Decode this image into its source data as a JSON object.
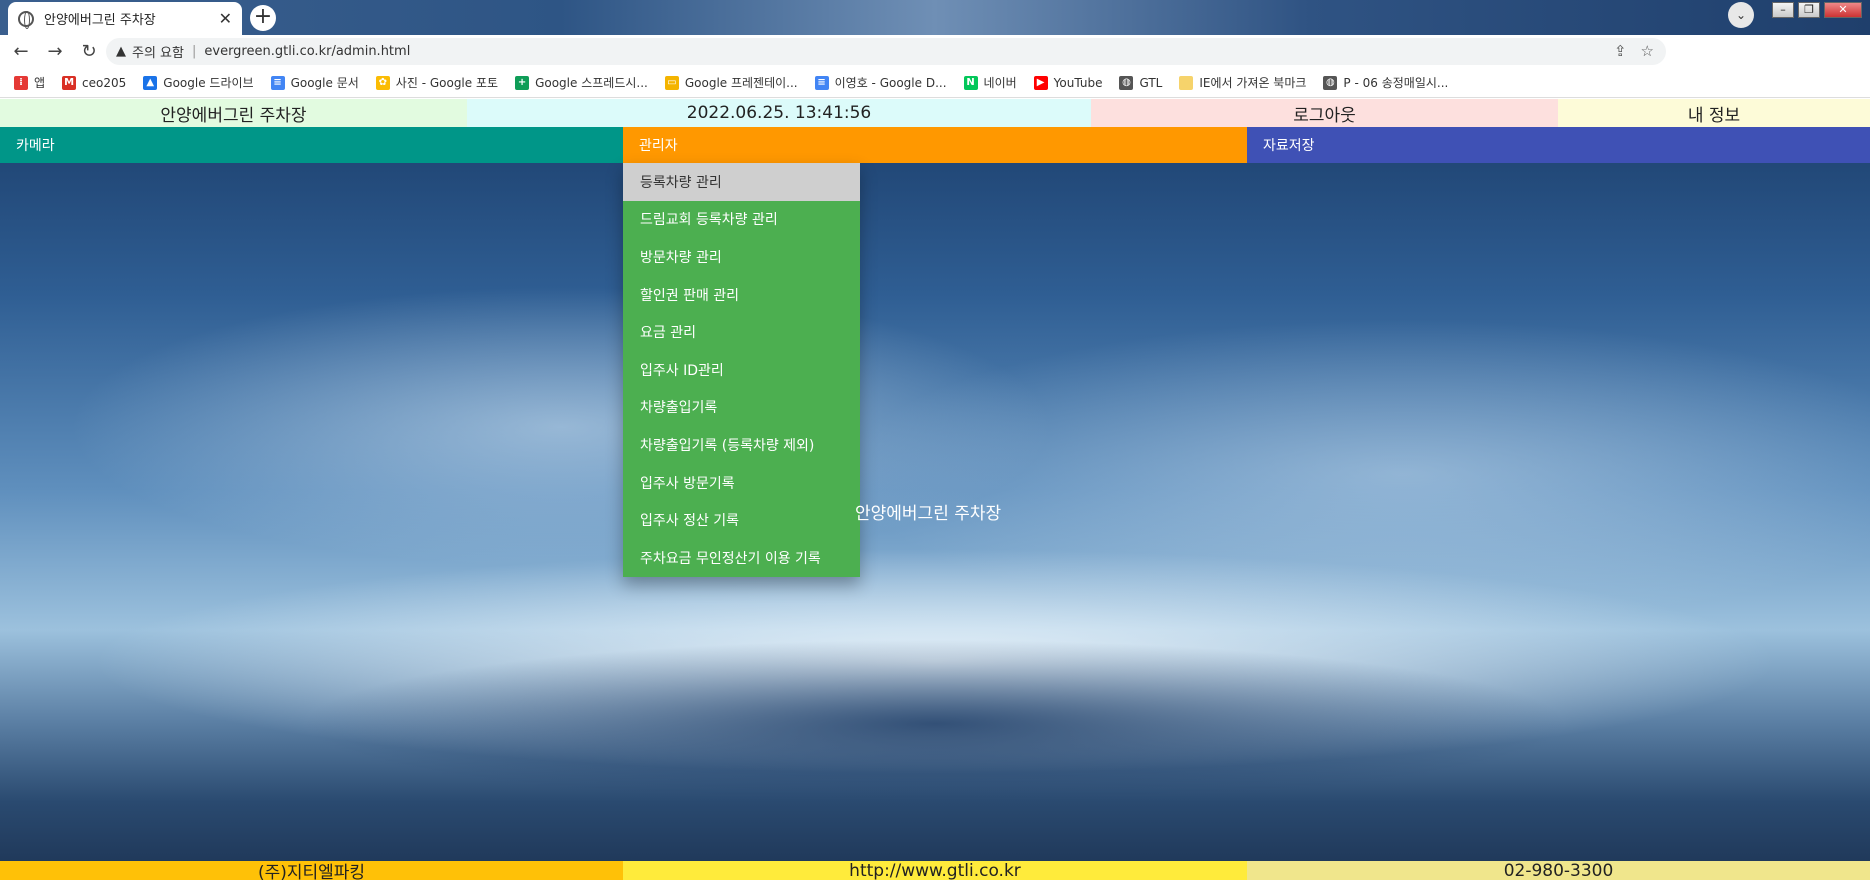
{
  "browser": {
    "tab_title": "안양에버그린 주차장",
    "security_label": "주의 요함",
    "url": "evergreen.gtli.co.kr/admin.html",
    "bookmarks": [
      {
        "label": "앱",
        "icon": "apps-grid-icon",
        "color": "#e53935"
      },
      {
        "label": "ceo205",
        "icon": "gmail-icon",
        "color": "#d93025"
      },
      {
        "label": "Google 드라이브",
        "icon": "google-drive-icon",
        "color": "#1a73e8"
      },
      {
        "label": "Google 문서",
        "icon": "google-docs-icon",
        "color": "#4285f4"
      },
      {
        "label": "사진 - Google 포토",
        "icon": "google-photos-icon",
        "color": "#fbbc04"
      },
      {
        "label": "Google 스프레드시...",
        "icon": "google-sheets-icon",
        "color": "#0f9d58"
      },
      {
        "label": "Google 프레젠테이...",
        "icon": "google-slides-icon",
        "color": "#f4b400"
      },
      {
        "label": "이영호 - Google D...",
        "icon": "google-docs-icon",
        "color": "#4285f4"
      },
      {
        "label": "네이버",
        "icon": "naver-icon",
        "color": "#03c75a"
      },
      {
        "label": "YouTube",
        "icon": "youtube-icon",
        "color": "#ff0000"
      },
      {
        "label": "GTL",
        "icon": "globe-icon",
        "color": "#555555"
      },
      {
        "label": "IE에서 가져온 북마크",
        "icon": "folder-icon",
        "color": "#f6d36b"
      },
      {
        "label": "P - 06 송정매일시...",
        "icon": "globe-icon",
        "color": "#555555"
      }
    ]
  },
  "info": {
    "lot_name": "안양에버그린 주차장",
    "datetime": "2022.06.25. 13:41:56",
    "logout": "로그아웃",
    "my_info": "내 정보"
  },
  "menu": {
    "camera": "카메라",
    "admin": "관리자",
    "data_save": "자료저장"
  },
  "admin_dropdown": [
    "등록차량 관리",
    "드림교회 등록차량 관리",
    "방문차량 관리",
    "할인권 판매 관리",
    "요금 관리",
    "입주사 ID관리",
    "차량출입기록",
    "차량출입기록 (등록차량 제외)",
    "입주사 방문기록",
    "입주사 정산 기록",
    "주차요금 무인정산기 이용 기록"
  ],
  "center_title": "안양에버그린 주차장",
  "footer": {
    "company": "(주)지티엘파킹",
    "website": "http://www.gtli.co.kr",
    "phone": "02-980-3300"
  }
}
